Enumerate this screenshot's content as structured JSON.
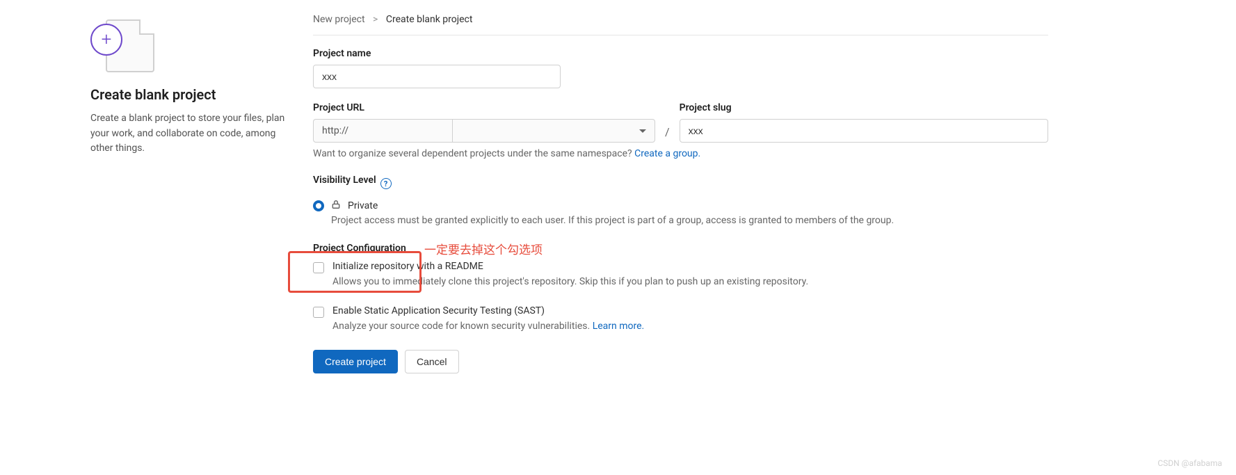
{
  "sidebar": {
    "title": "Create blank project",
    "description": "Create a blank project to store your files, plan your work, and collaborate on code, among other things."
  },
  "breadcrumb": {
    "parent": "New project",
    "separator": ">",
    "current": "Create blank project"
  },
  "form": {
    "name_label": "Project name",
    "name_value": "xxx",
    "url_label": "Project URL",
    "url_prefix": "http://",
    "url_namespace": "",
    "slash": "/",
    "slug_label": "Project slug",
    "slug_value": "xxx",
    "namespace_hint_text": "Want to organize several dependent projects under the same namespace? ",
    "namespace_hint_link": "Create a group.",
    "visibility_label": "Visibility Level",
    "private": {
      "label": "Private",
      "description": "Project access must be granted explicitly to each user. If this project is part of a group, access is granted to members of the group."
    },
    "config_label": "Project Configuration",
    "readme": {
      "label": "Initialize repository with a README",
      "description": "Allows you to immediately clone this project's repository. Skip this if you plan to push up an existing repository."
    },
    "sast": {
      "label": "Enable Static Application Security Testing (SAST)",
      "description_prefix": "Analyze your source code for known security vulnerabilities. ",
      "learn_more": "Learn more."
    },
    "create_button": "Create project",
    "cancel_button": "Cancel"
  },
  "annotation": {
    "text": "一定要去掉这个勾选项"
  },
  "watermark": "CSDN @afabama"
}
